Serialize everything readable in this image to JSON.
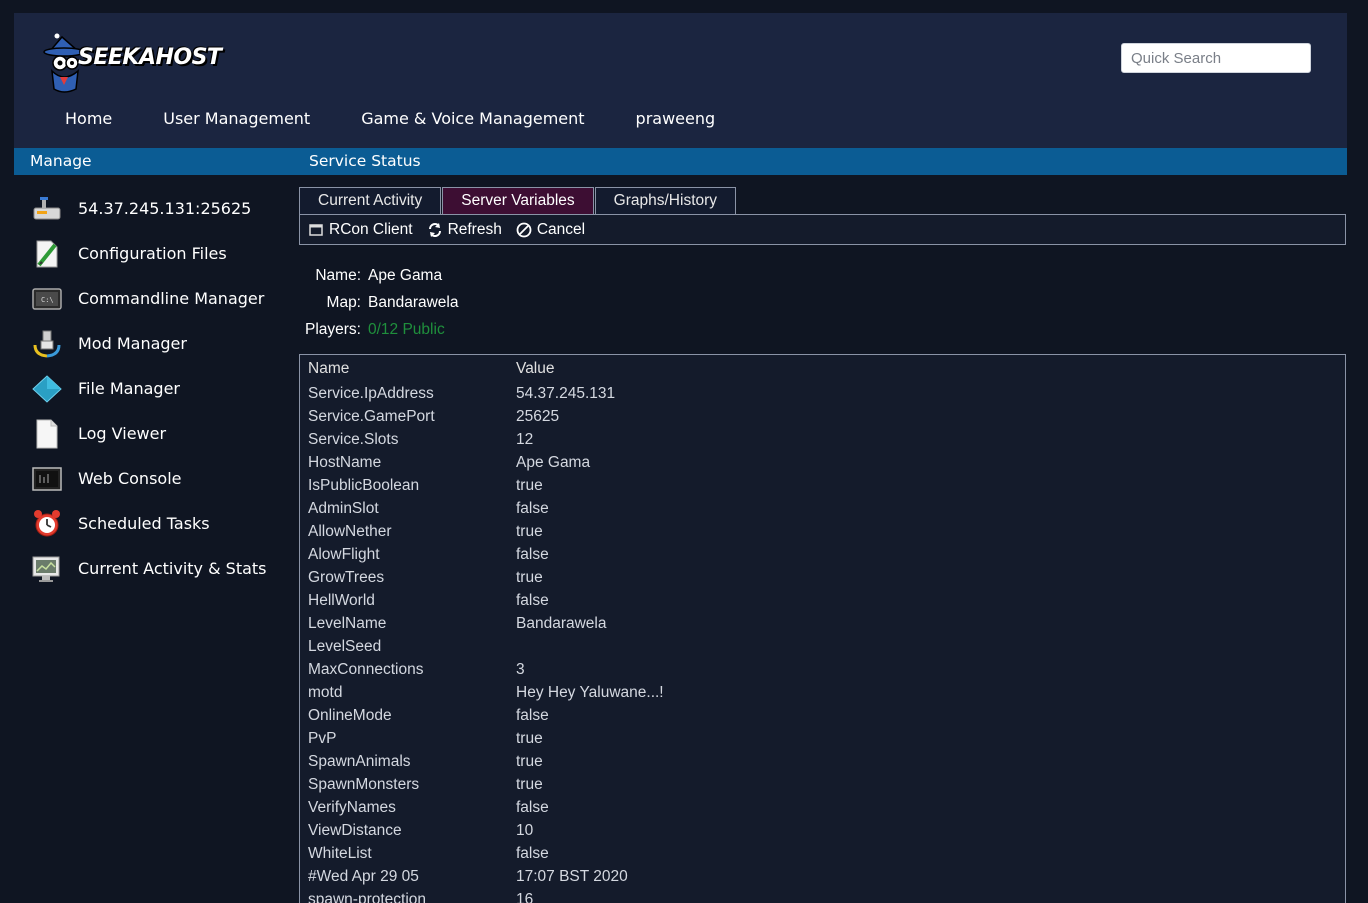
{
  "brand": {
    "name": "SEEKAHOST"
  },
  "search": {
    "placeholder": "Quick Search"
  },
  "nav": [
    "Home",
    "User Management",
    "Game & Voice Management",
    "praweeng"
  ],
  "bar": {
    "left": "Manage",
    "right": "Service Status"
  },
  "sidebar": [
    {
      "label": "54.37.245.131:25625",
      "icon": "server-icon"
    },
    {
      "label": "Configuration Files",
      "icon": "config-file-icon"
    },
    {
      "label": "Commandline Manager",
      "icon": "terminal-icon"
    },
    {
      "label": "Mod Manager",
      "icon": "mod-icon"
    },
    {
      "label": "File Manager",
      "icon": "folder-icon"
    },
    {
      "label": "Log Viewer",
      "icon": "log-file-icon"
    },
    {
      "label": "Web Console",
      "icon": "console-icon"
    },
    {
      "label": "Scheduled Tasks",
      "icon": "alarm-clock-icon"
    },
    {
      "label": "Current Activity & Stats",
      "icon": "monitor-stats-icon"
    }
  ],
  "tabs": [
    "Current Activity",
    "Server Variables",
    "Graphs/History"
  ],
  "toolbar": {
    "rcon": "RCon Client",
    "refresh": "Refresh",
    "cancel": "Cancel"
  },
  "info": {
    "name_label": "Name:",
    "name": "Ape Gama",
    "map_label": "Map:",
    "map": "Bandarawela",
    "players_label": "Players:",
    "players": "0/12 Public"
  },
  "table": {
    "headers": [
      "Name",
      "Value"
    ],
    "rows": [
      [
        "Service.IpAddress",
        "54.37.245.131"
      ],
      [
        "Service.GamePort",
        "25625"
      ],
      [
        "Service.Slots",
        "12"
      ],
      [
        "HostName",
        "Ape Gama"
      ],
      [
        "IsPublicBoolean",
        "true"
      ],
      [
        "AdminSlot",
        "false"
      ],
      [
        "AllowNether",
        "true"
      ],
      [
        "AlowFlight",
        "false"
      ],
      [
        "GrowTrees",
        "true"
      ],
      [
        "HellWorld",
        "false"
      ],
      [
        "LevelName",
        "Bandarawela"
      ],
      [
        "LevelSeed",
        ""
      ],
      [
        "MaxConnections",
        "3"
      ],
      [
        "motd",
        "Hey Hey Yaluwane...!"
      ],
      [
        "OnlineMode",
        "false"
      ],
      [
        "PvP",
        "true"
      ],
      [
        "SpawnAnimals",
        "true"
      ],
      [
        "SpawnMonsters",
        "true"
      ],
      [
        "VerifyNames",
        "false"
      ],
      [
        "ViewDistance",
        "10"
      ],
      [
        "WhiteList",
        "false"
      ],
      [
        "#Wed Apr 29 05",
        "17:07 BST 2020"
      ],
      [
        "spawn-protection",
        "16"
      ]
    ]
  }
}
